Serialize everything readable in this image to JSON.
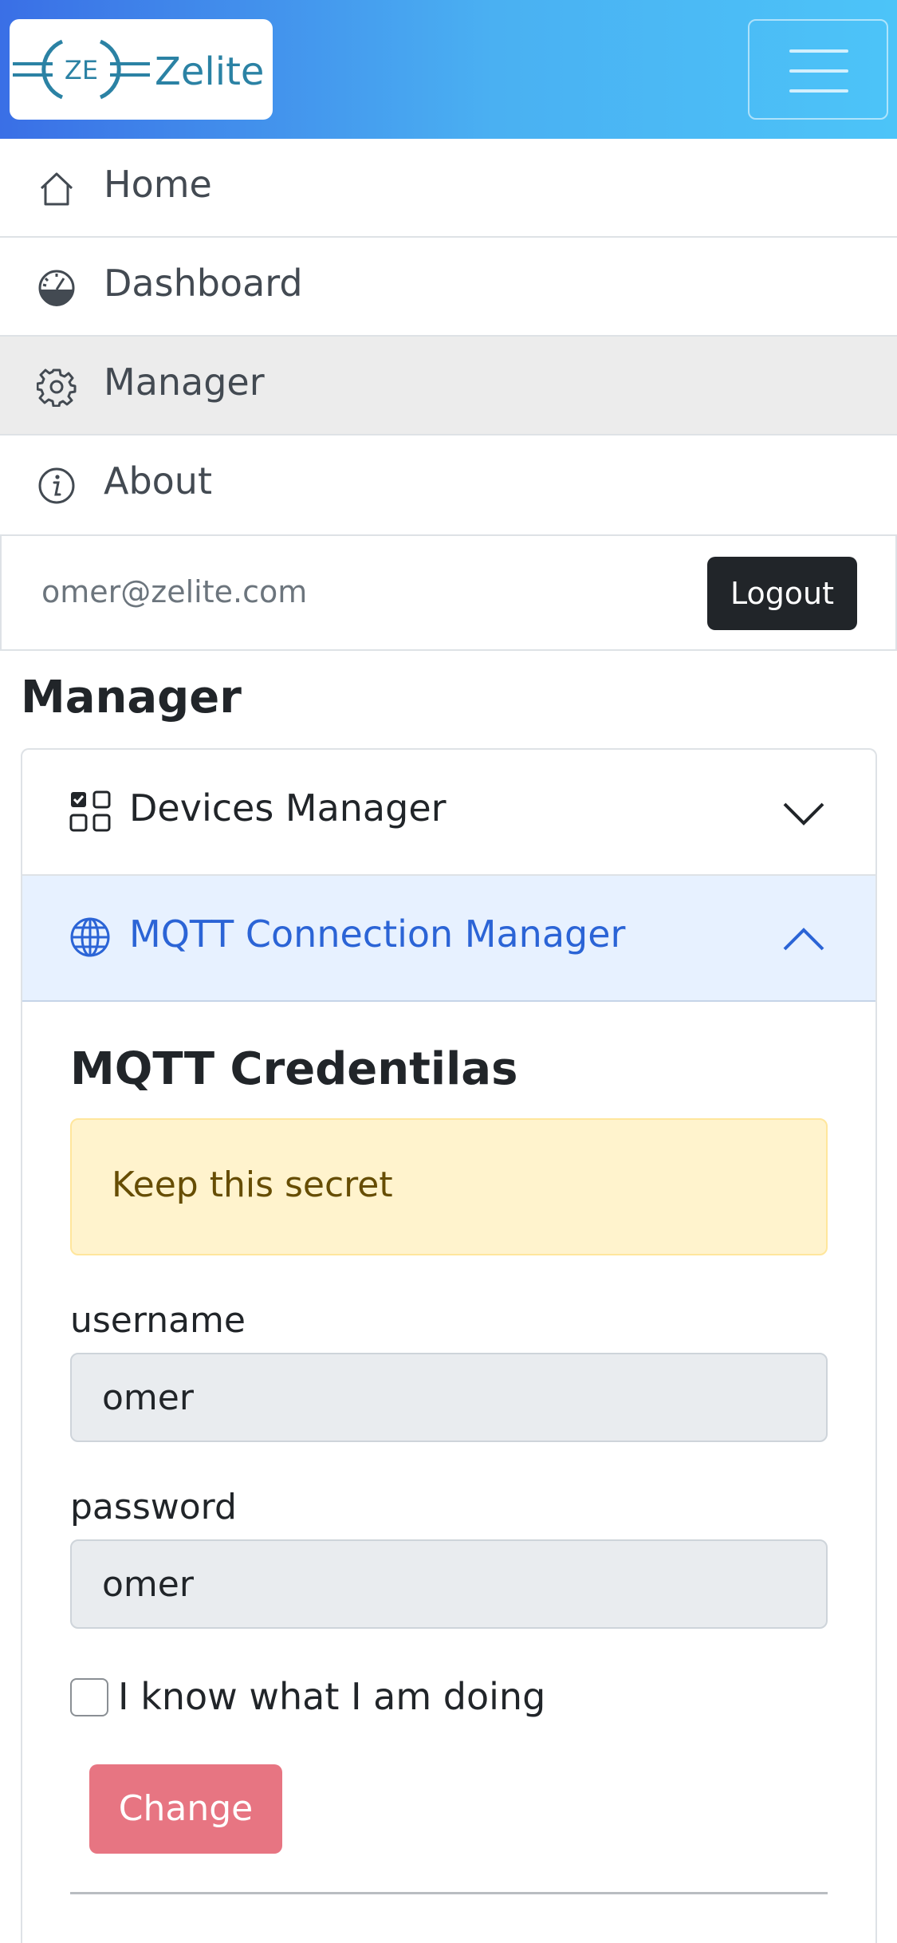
{
  "header": {
    "logo_mark": "ZE",
    "brand_name": "Zelite",
    "menu_icon": "hamburger-menu-icon"
  },
  "nav": {
    "items": [
      {
        "label": "Home",
        "icon": "home-icon"
      },
      {
        "label": "Dashboard",
        "icon": "speedometer-icon"
      },
      {
        "label": "Manager",
        "icon": "gear-icon",
        "active": true
      },
      {
        "label": "About",
        "icon": "info-circle-icon"
      }
    ]
  },
  "account": {
    "email": "omer@zelite.com",
    "logout_label": "Logout"
  },
  "page": {
    "title": "Manager"
  },
  "accordion": {
    "devices": {
      "label": "Devices Manager",
      "icon": "ui-checks-grid-icon",
      "expanded": false
    },
    "mqtt": {
      "label": "MQTT Connection Manager",
      "icon": "globe-icon",
      "expanded": true
    }
  },
  "mqtt_panel": {
    "title": "MQTT Credentilas",
    "alert": "Keep this secret",
    "username_label": "username",
    "username_value": "omer",
    "password_label": "password",
    "password_value": "omer",
    "confirm_label": "I know what I am doing",
    "confirm_checked": false,
    "change_label": "Change"
  },
  "colors": {
    "header_gradient_start": "#3a6fe6",
    "header_gradient_end": "#4cc4f8",
    "accent_blue": "#2b64d6",
    "alert_bg": "#fff3cd",
    "change_button": "#e77582",
    "logout_button": "#212529"
  }
}
